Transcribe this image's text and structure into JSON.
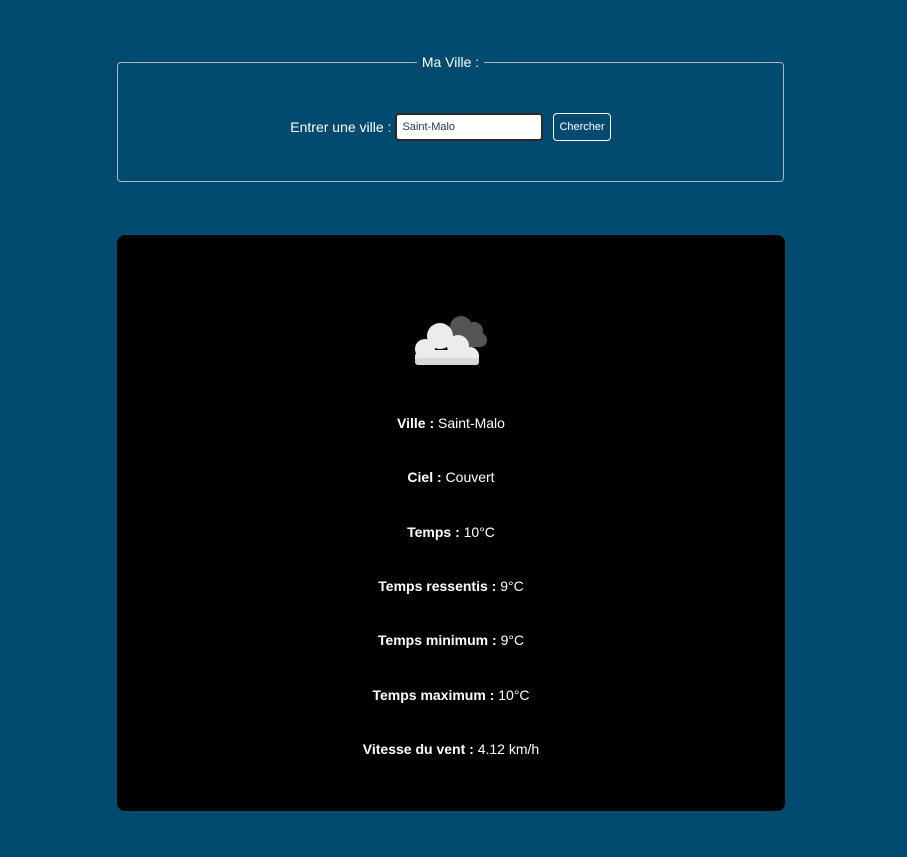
{
  "search": {
    "legend": "Ma Ville :",
    "label": "Entrer une ville :",
    "input_value": "Saint-Malo",
    "button_label": "Chercher"
  },
  "weather": {
    "icon": "cloud-icon",
    "rows": [
      {
        "label": "Ville :",
        "value": "Saint-Malo"
      },
      {
        "label": "Ciel :",
        "value": "Couvert"
      },
      {
        "label": "Temps :",
        "value": "10°C"
      },
      {
        "label": "Temps ressentis :",
        "value": "9°C"
      },
      {
        "label": "Temps minimum :",
        "value": "9°C"
      },
      {
        "label": "Temps maximum :",
        "value": "10°C"
      },
      {
        "label": "Vitesse du vent :",
        "value": "4.12 km/h"
      }
    ]
  },
  "colors": {
    "background": "#004a6f",
    "card": "#000000",
    "text": "#ffffff"
  }
}
